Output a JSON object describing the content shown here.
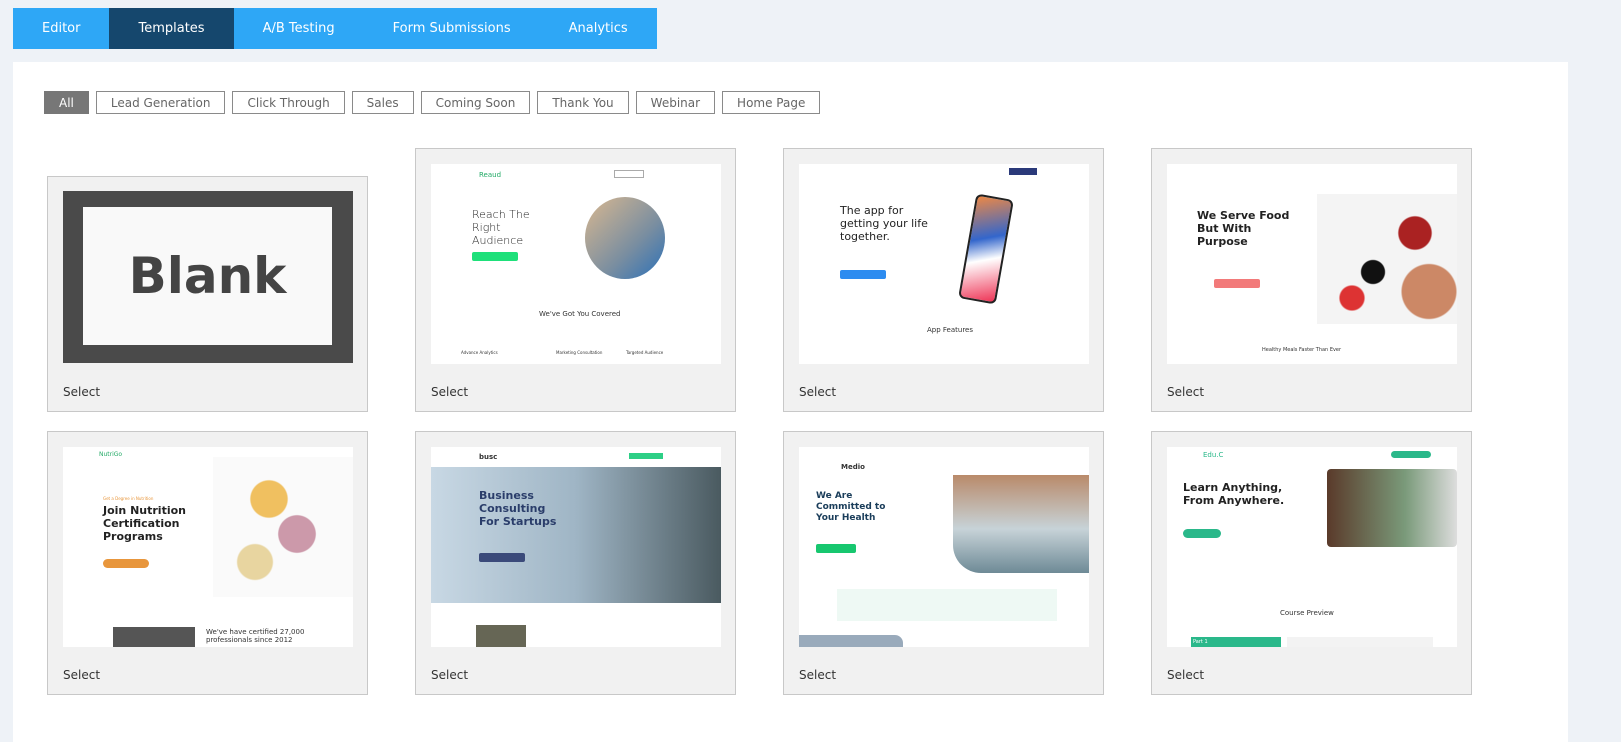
{
  "tabs": [
    "Editor",
    "Templates",
    "A/B Testing",
    "Form Submissions",
    "Analytics"
  ],
  "active_tab": "Templates",
  "filters": [
    "All",
    "Lead Generation",
    "Click Through",
    "Sales",
    "Coming Soon",
    "Thank You",
    "Webinar",
    "Home Page"
  ],
  "active_filter": "All",
  "select_label": "Select",
  "templates": [
    {
      "blank_label": "Blank"
    },
    {
      "brand": "Reaud",
      "headline": "Reach The Right Audience",
      "section": "We've Got You Covered",
      "features": [
        "Advance Analytics",
        "Marketing Consultation",
        "Targeted Audience"
      ]
    },
    {
      "headline": "The app for getting your life together.",
      "section": "App Features"
    },
    {
      "headline": "We Serve Food But With Purpose",
      "section": "Healthy Meals Faster Than Ever"
    },
    {
      "brand": "NutriGo",
      "kicker": "Get a Degree in Nutrition",
      "headline": "Join Nutrition Certification Programs",
      "section": "We've have certified 27,000 professionals since 2012"
    },
    {
      "brand": "busc",
      "headline": "Business Consulting For Startups"
    },
    {
      "brand": "Medio",
      "headline": "We Are Committed to Your Health"
    },
    {
      "brand": "Edu.C",
      "headline": "Learn Anything, From Anywhere.",
      "section": "Course Preview",
      "part": "Part 1"
    }
  ],
  "colors": {
    "tab_bar": "#2ea7f6",
    "tab_active": "#15476d",
    "filter_active": "#777777"
  }
}
